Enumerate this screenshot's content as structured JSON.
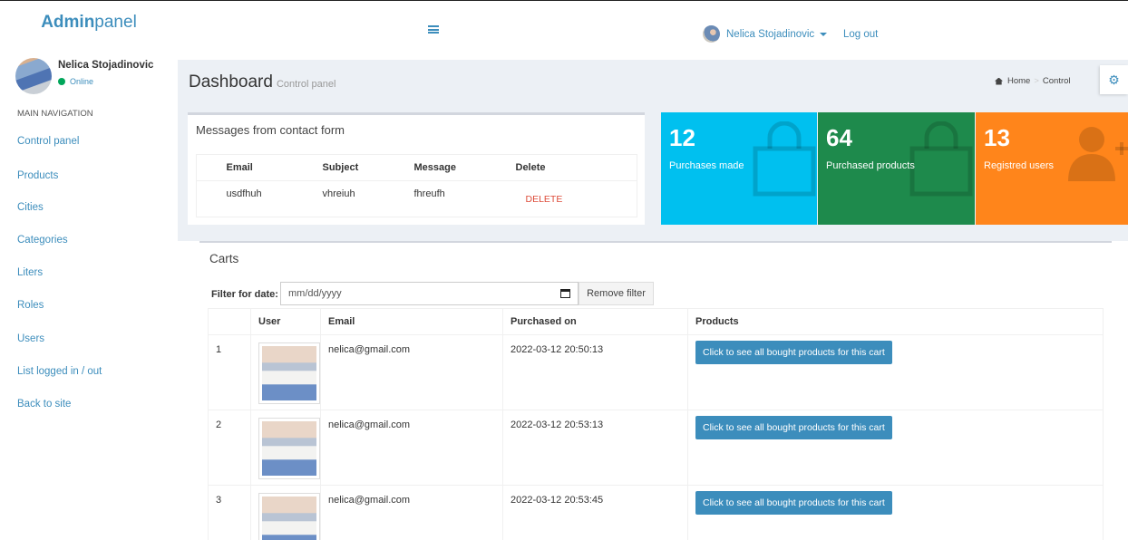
{
  "header": {
    "logo_bold": "Admin",
    "logo_rest": "panel",
    "user_name": "Nelica Stojadinovic",
    "logout": "Log out"
  },
  "sidebar": {
    "user_name": "Nelica Stojadinovic",
    "status": "Online",
    "nav_header": "MAIN NAVIGATION",
    "items": [
      {
        "label": "Control panel"
      },
      {
        "label": "Products"
      },
      {
        "label": "Cities"
      },
      {
        "label": "Categories"
      },
      {
        "label": "Liters"
      },
      {
        "label": "Roles"
      },
      {
        "label": "Users"
      },
      {
        "label": "List logged in / out"
      },
      {
        "label": "Back to site"
      }
    ]
  },
  "page": {
    "title": "Dashboard",
    "subtitle": "Control panel",
    "breadcrumb_home": "Home",
    "breadcrumb_current": "Control"
  },
  "messages": {
    "title": "Messages from contact form",
    "columns": [
      "Email",
      "Subject",
      "Message",
      "Delete"
    ],
    "rows": [
      {
        "email": "usdfhuh",
        "subject": "vhreiuh",
        "message": "fhreufh",
        "delete": "DELETE"
      }
    ]
  },
  "stats": [
    {
      "value": "12",
      "label": "Purchases made",
      "color": "#00c0ef",
      "icon": "shopping-bag-icon"
    },
    {
      "value": "64",
      "label": "Purchased products",
      "color": "#1e8a4c",
      "icon": "shopping-bag-icon"
    },
    {
      "value": "13",
      "label": "Registred users",
      "color": "#ff851b",
      "icon": "user-add-icon"
    }
  ],
  "carts": {
    "title": "Carts",
    "filter_label": "Filter for date:",
    "date_placeholder": "mm/dd/yyyy",
    "remove_filter": "Remove filter",
    "columns": [
      "",
      "User",
      "Email",
      "Purchased on",
      "Products"
    ],
    "rows": [
      {
        "num": "1",
        "email": "nelica@gmail.com",
        "date": "2022-03-12 20:50:13",
        "button": "Click to see all bought products for this cart"
      },
      {
        "num": "2",
        "email": "nelica@gmail.com",
        "date": "2022-03-12 20:53:13",
        "button": "Click to see all bought products for this cart"
      },
      {
        "num": "3",
        "email": "nelica@gmail.com",
        "date": "2022-03-12 20:53:45",
        "button": "Click to see all bought products for this cart"
      }
    ]
  }
}
